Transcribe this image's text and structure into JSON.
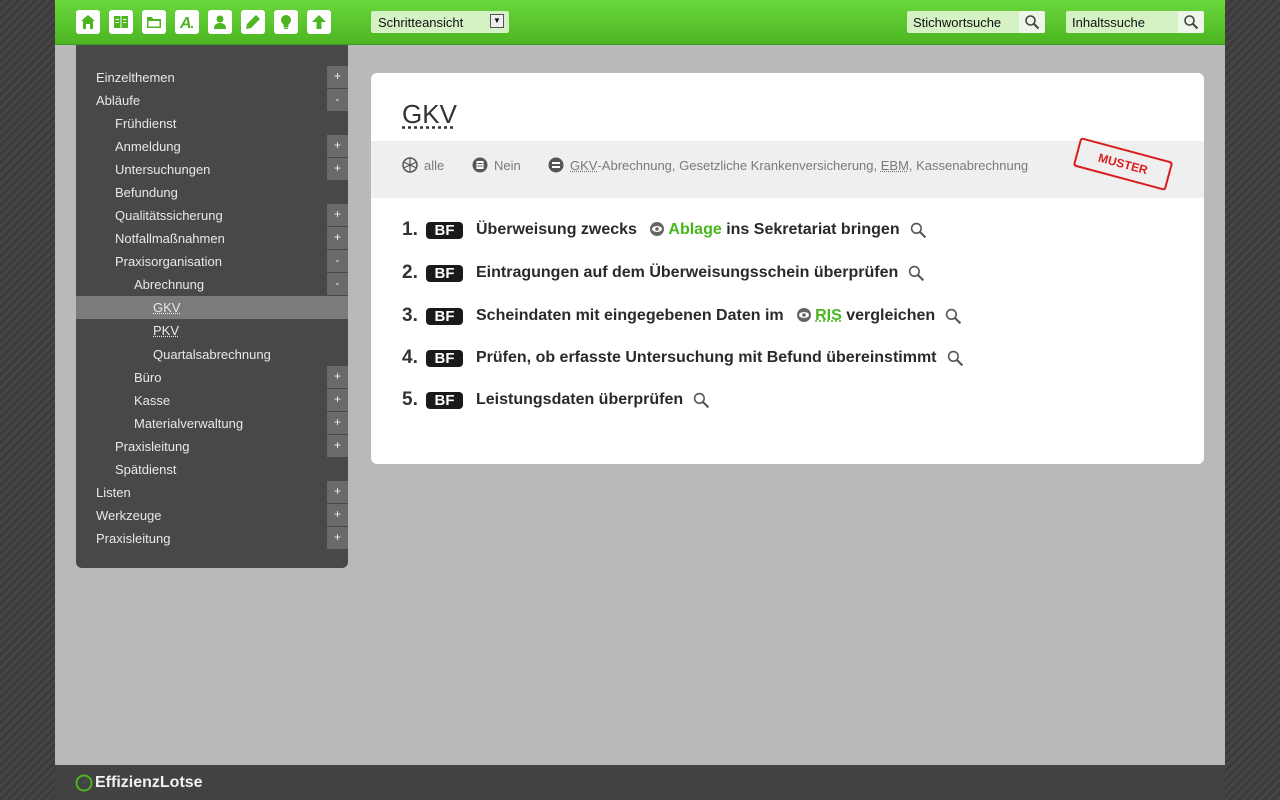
{
  "toolbar": {
    "icons": [
      "home-icon",
      "book-icon",
      "folder-icon",
      "font-a-icon",
      "user-icon",
      "pencil-icon",
      "lightbulb-icon",
      "arrow-up-icon"
    ],
    "view_select": "Schritteansicht",
    "keyword_search": "Stichwortsuche",
    "content_search": "Inhaltssuche"
  },
  "sidebar": {
    "items": [
      {
        "label": "Einzelthemen",
        "toggle": "+"
      },
      {
        "label": "Abläufe",
        "toggle": "-"
      },
      {
        "label": "Frühdienst",
        "toggle": ""
      },
      {
        "label": "Anmeldung",
        "toggle": "+"
      },
      {
        "label": "Untersuchungen",
        "toggle": "+"
      },
      {
        "label": "Befundung",
        "toggle": ""
      },
      {
        "label": "Qualitätssicherung",
        "toggle": "+"
      },
      {
        "label": "Notfallmaßnahmen",
        "toggle": "+"
      },
      {
        "label": "Praxisorganisation",
        "toggle": "-"
      },
      {
        "label": "Abrechnung",
        "toggle": "-"
      },
      {
        "label": "GKV",
        "toggle": ""
      },
      {
        "label": "PKV",
        "toggle": ""
      },
      {
        "label": "Quartalsabrechnung",
        "toggle": ""
      },
      {
        "label": "Büro",
        "toggle": "+"
      },
      {
        "label": "Kasse",
        "toggle": "+"
      },
      {
        "label": "Materialverwaltung",
        "toggle": "+"
      },
      {
        "label": "Praxisleitung",
        "toggle": "+"
      },
      {
        "label": "Spätdienst",
        "toggle": ""
      },
      {
        "label": "Listen",
        "toggle": "+"
      },
      {
        "label": "Werkzeuge",
        "toggle": "+"
      },
      {
        "label": "Praxisleitung",
        "toggle": "+"
      }
    ]
  },
  "card": {
    "title": "GKV",
    "meta": {
      "scope": "alle",
      "print": "Nein",
      "tags_abbr1": "GKV",
      "tags_rest1": "-Abrechnung, Gesetzliche Krankenversicherung, ",
      "tags_abbr2": "EBM",
      "tags_rest2": ", Kassenabrechnung"
    },
    "stamp": "MUSTER",
    "steps": [
      {
        "num": "1.",
        "badge": "BF",
        "pre": "Überweisung zwecks",
        "link": "Ablage",
        "post": "ins Sekretariat bringen"
      },
      {
        "num": "2.",
        "badge": "BF",
        "text": "Eintragungen auf dem Überweisungsschein überprüfen"
      },
      {
        "num": "3.",
        "badge": "BF",
        "pre": "Scheindaten mit eingegebenen Daten im",
        "link": "RIS",
        "post": "vergleichen"
      },
      {
        "num": "4.",
        "badge": "BF",
        "text": "Prüfen, ob erfasste Untersuchung mit Befund übereinstimmt"
      },
      {
        "num": "5.",
        "badge": "BF",
        "text": "Leistungsdaten überprüfen"
      }
    ]
  },
  "footer": {
    "logo": "EffizienzLotse"
  },
  "colors": {
    "accent": "#4cb521",
    "sidebar": "#484848",
    "stamp": "#d91c1c"
  }
}
